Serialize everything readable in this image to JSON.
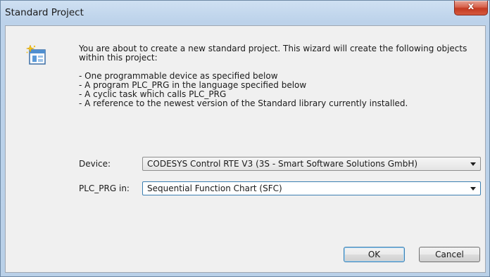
{
  "window": {
    "title": "Standard Project",
    "close_glyph": "x"
  },
  "intro": {
    "paragraph": "You are about to create a new standard project. This wizard will create the following objects within this project:",
    "bullets": [
      "- One programmable device as specified below",
      "- A program PLC_PRG in the language specified below",
      "- A cyclic task which calls PLC_PRG",
      "- A reference to the newest version of the Standard library currently installed."
    ]
  },
  "device": {
    "label": "Device:",
    "value": "CODESYS Control RTE V3 (3S - Smart Software Solutions GmbH)"
  },
  "language": {
    "label": "PLC_PRG in:",
    "value": "Sequential Function Chart (SFC)"
  },
  "buttons": {
    "ok": "OK",
    "cancel": "Cancel"
  },
  "icons": {
    "wizard": "wizard-sparkle-window-icon"
  },
  "colors": {
    "focus_border": "#3c7fb1",
    "close_red": "#c43a21",
    "frame_blue": "#bcd2ea"
  }
}
